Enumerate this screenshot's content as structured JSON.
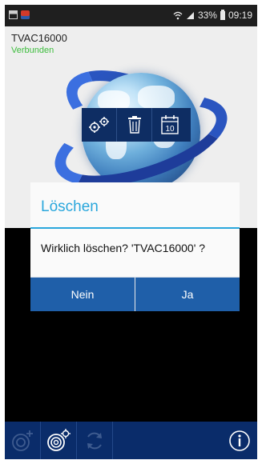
{
  "status_bar": {
    "battery": "33%",
    "time": "09:19"
  },
  "device": {
    "name": "TVAC16000",
    "status": "Verbunden",
    "status_color": "#3dbd3d"
  },
  "action_bar": {
    "items": [
      {
        "icon": "gears-icon"
      },
      {
        "icon": "trash-icon"
      },
      {
        "icon": "calendar-icon",
        "label": "10"
      }
    ]
  },
  "dialog": {
    "title": "Löschen",
    "message": "Wirklich löschen? 'TVAC16000' ?",
    "no_label": "Nein",
    "yes_label": "Ja"
  },
  "bottom_bar": {
    "items": [
      {
        "icon": "add-camera-icon",
        "enabled": false
      },
      {
        "icon": "camera-settings-icon",
        "enabled": true
      },
      {
        "icon": "refresh-icon",
        "enabled": false
      },
      {
        "icon": "info-icon",
        "enabled": true
      }
    ]
  },
  "colors": {
    "accent": "#2aa7dc",
    "button_blue": "#1f5fa9",
    "bar_blue": "#0a2c6a"
  }
}
